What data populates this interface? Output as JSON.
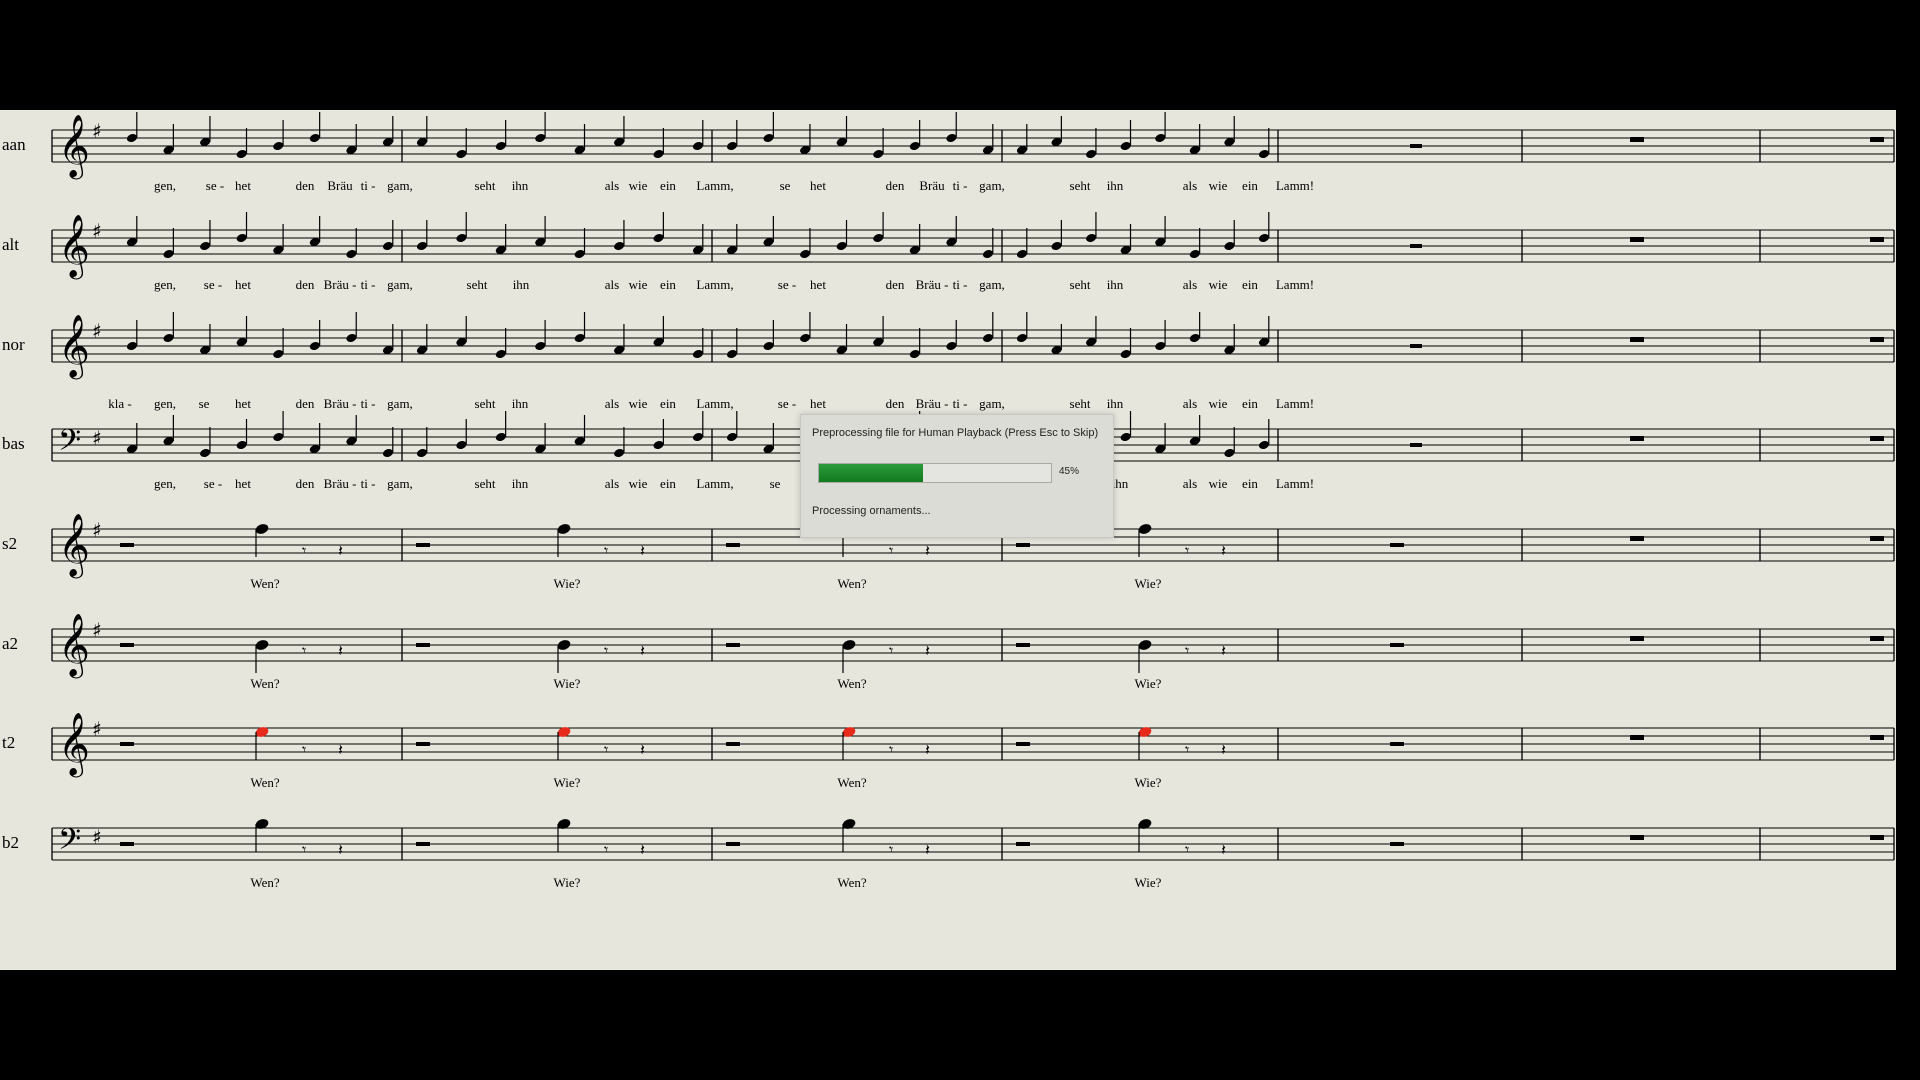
{
  "app": {
    "background": "#000000",
    "paper": "#e6e6dd",
    "ink": "#000000",
    "highlight": "#e82a1c"
  },
  "dialog": {
    "title": "Preprocessing file for Human Playback (Press Esc to Skip)",
    "progress_fraction": 0.45,
    "percent_label": "45%",
    "status": "Processing ornaments...",
    "bar_color": "#1f8a2c"
  },
  "score": {
    "key_signature": "G major (1 sharp)",
    "staves": [
      {
        "label": "aan",
        "clef": "treble",
        "lyrics": [
          "gen,",
          "se -",
          "het",
          "den",
          "Bräu",
          "ti -",
          "gam,",
          "seht",
          "ihn",
          "als",
          "wie",
          "ein",
          "Lamm,",
          "se",
          "het",
          "den",
          "Bräu",
          "ti -",
          "gam,",
          "seht",
          "ihn",
          "als",
          "wie",
          "ein",
          "Lamm!"
        ]
      },
      {
        "label": "alt",
        "clef": "treble",
        "lyrics": [
          "gen,",
          "se -",
          "het",
          "den",
          "Bräu -",
          "ti -",
          "gam,",
          "seht",
          "ihn",
          "als",
          "wie",
          "ein",
          "Lamm,",
          "se -",
          "het",
          "den",
          "Bräu -",
          "ti -",
          "gam,",
          "seht",
          "ihn",
          "als",
          "wie",
          "ein",
          "Lamm!"
        ]
      },
      {
        "label": "nor",
        "clef": "treble",
        "lyrics": [
          "kla -",
          "gen,",
          "se",
          "het",
          "den",
          "Bräu -",
          "ti -",
          "gam,",
          "seht",
          "ihn",
          "als",
          "wie",
          "ein",
          "Lamm,",
          "se -",
          "het",
          "den",
          "Bräu -",
          "ti -",
          "gam,",
          "seht",
          "ihn",
          "als",
          "wie",
          "ein",
          "Lamm!"
        ]
      },
      {
        "label": "bas",
        "clef": "bass",
        "lyrics": [
          "gen,",
          "se -",
          "het",
          "den",
          "Bräu -",
          "ti -",
          "gam,",
          "seht",
          "ihn",
          "als",
          "wie",
          "ein",
          "Lamm,",
          "se",
          "ihn",
          "als",
          "wie",
          "ein",
          "Lamm!"
        ]
      },
      {
        "label": "s2",
        "clef": "treble",
        "lyrics": [
          "Wen?",
          "Wie?",
          "Wen?",
          "Wie?"
        ]
      },
      {
        "label": "a2",
        "clef": "treble",
        "lyrics": [
          "Wen?",
          "Wie?",
          "Wen?",
          "Wie?"
        ]
      },
      {
        "label": "t2",
        "clef": "treble",
        "lyrics": [
          "Wen?",
          "Wie?",
          "Wen?",
          "Wie?"
        ]
      },
      {
        "label": "b2",
        "clef": "bass",
        "lyrics": [
          "Wen?",
          "Wie?",
          "Wen?",
          "Wie?"
        ]
      }
    ]
  }
}
